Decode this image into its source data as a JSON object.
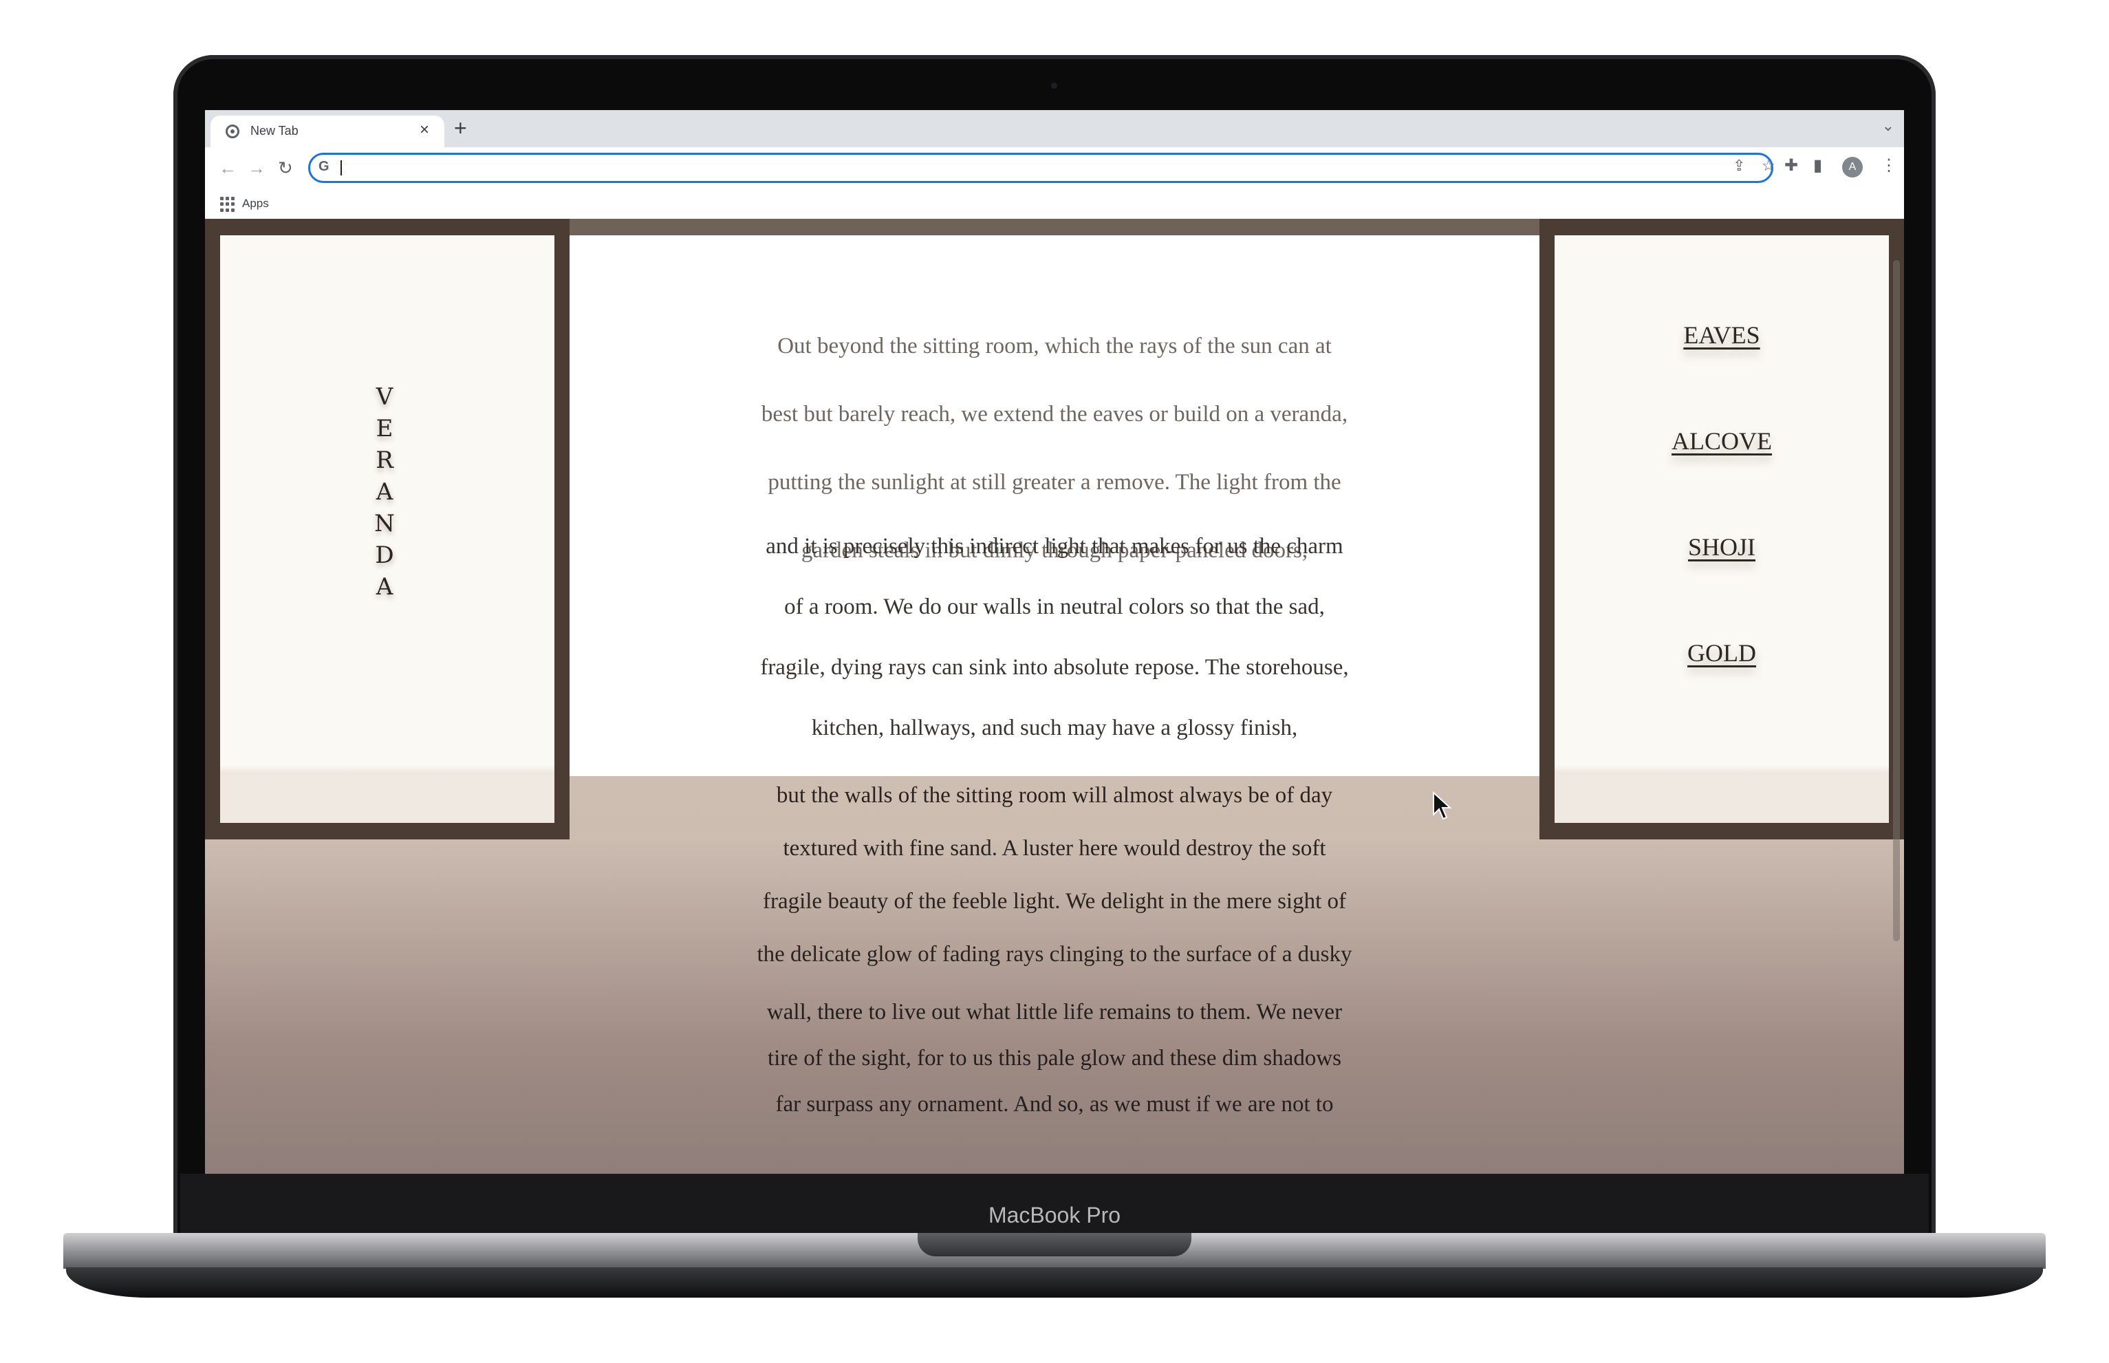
{
  "device": {
    "label": "MacBook Pro"
  },
  "browser": {
    "tab": {
      "title": "New Tab",
      "close_symbol": "×"
    },
    "new_tab_symbol": "+",
    "tab_menu_symbol": "⌄",
    "nav": {
      "back": "←",
      "forward": "→",
      "reload": "↻"
    },
    "omnibox": {
      "g_label": "G",
      "value": ""
    },
    "bookmarks": {
      "apps_label": "Apps"
    },
    "avatar_letter": "A"
  },
  "page": {
    "left_word_letters": [
      "V",
      "E",
      "R",
      "A",
      "N",
      "D",
      "A"
    ],
    "nav_links": [
      "EAVES",
      "ALCOVE",
      "SHOJI",
      "GOLD"
    ],
    "paragraph_1": [
      "Out beyond the sitting room, which the rays of the sun can at",
      "best but barely reach, we extend the eaves or build on a veranda,",
      "putting the sunlight at still greater a remove. The light from the",
      "garden steals in but dimly through paper-paneled doors,"
    ],
    "paragraph_2": [
      "and it is precisely this indirect light that makes for us the charm",
      "of a room. We do our walls in neutral colors so that the sad,",
      "fragile, dying rays can sink into absolute repose. The storehouse,",
      "kitchen, hallways, and such may have a glossy finish,"
    ],
    "paragraph_3": [
      "but the walls of the sitting room will almost always be of day",
      "textured with fine sand. A luster here would destroy the soft",
      "fragile beauty of the feeble light. We delight in the mere sight of",
      "the delicate glow of fading rays clinging to the surface of a dusky"
    ],
    "paragraph_4": [
      "wall, there to live out what little life remains to them. We never",
      "tire of the sight, for to us this pale glow and these dim shadows",
      "far surpass any ornament. And so, as we must if we are not to"
    ]
  },
  "colors": {
    "frame_dark": "#4b3d33",
    "beam": "#6e6356",
    "panel_bg": "#fbf9f4",
    "omnibox_focus": "#1a73e8"
  }
}
